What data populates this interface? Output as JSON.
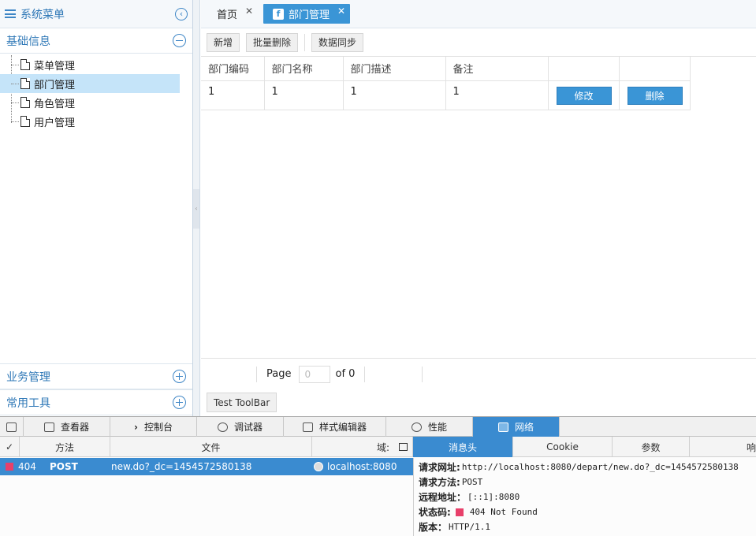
{
  "left": {
    "title": "系统菜单",
    "collapse_icon": "chevron-left-circle-icon",
    "section_basic": "基础信息",
    "tree": [
      {
        "label": "菜单管理",
        "selected": false
      },
      {
        "label": "部门管理",
        "selected": true
      },
      {
        "label": "角色管理",
        "selected": false
      },
      {
        "label": "用户管理",
        "selected": false
      }
    ],
    "section_business": "业务管理",
    "section_tools": "常用工具"
  },
  "tabs": [
    {
      "label": "首页",
      "active": false
    },
    {
      "label": "部门管理",
      "active": true
    }
  ],
  "toolbar": {
    "add": "新增",
    "batch_delete": "批量删除",
    "sync": "数据同步"
  },
  "grid": {
    "columns": [
      "部门编码",
      "部门名称",
      "部门描述",
      "备注",
      "",
      ""
    ],
    "rows": [
      {
        "code": "1",
        "name": "1",
        "desc": "1",
        "remark": "1",
        "edit": "修改",
        "delete": "删除"
      }
    ]
  },
  "pager": {
    "page_label": "Page",
    "page_value": "0",
    "of_label": "of 0"
  },
  "bottom_toolbar": {
    "test": "Test ToolBar"
  },
  "devtools": {
    "tabs": [
      "查看器",
      "控制台",
      "调试器",
      "样式编辑器",
      "性能",
      "网络"
    ],
    "active_tab": "网络",
    "columns": {
      "check": "✓",
      "method": "方法",
      "file": "文件",
      "domain": "域:"
    },
    "detail_tabs": [
      "消息头",
      "Cookie",
      "参数",
      "响"
    ],
    "request": {
      "status": "404",
      "method": "POST",
      "file": "new.do?_dc=1454572580138",
      "host": "localhost:8080"
    },
    "details": [
      {
        "key": "请求网址:",
        "value": "http://localhost:8080/depart/new.do?_dc=1454572580138"
      },
      {
        "key": "请求方法:",
        "value": "POST"
      },
      {
        "key": "远程地址：",
        "value": "[::1]:8080"
      },
      {
        "key": "状态码:",
        "value": "404 Not Found"
      },
      {
        "key": "版本：",
        "value": "HTTP/1.1"
      }
    ],
    "status_color": "#e8406a",
    "accent": "#3a8bd0"
  }
}
